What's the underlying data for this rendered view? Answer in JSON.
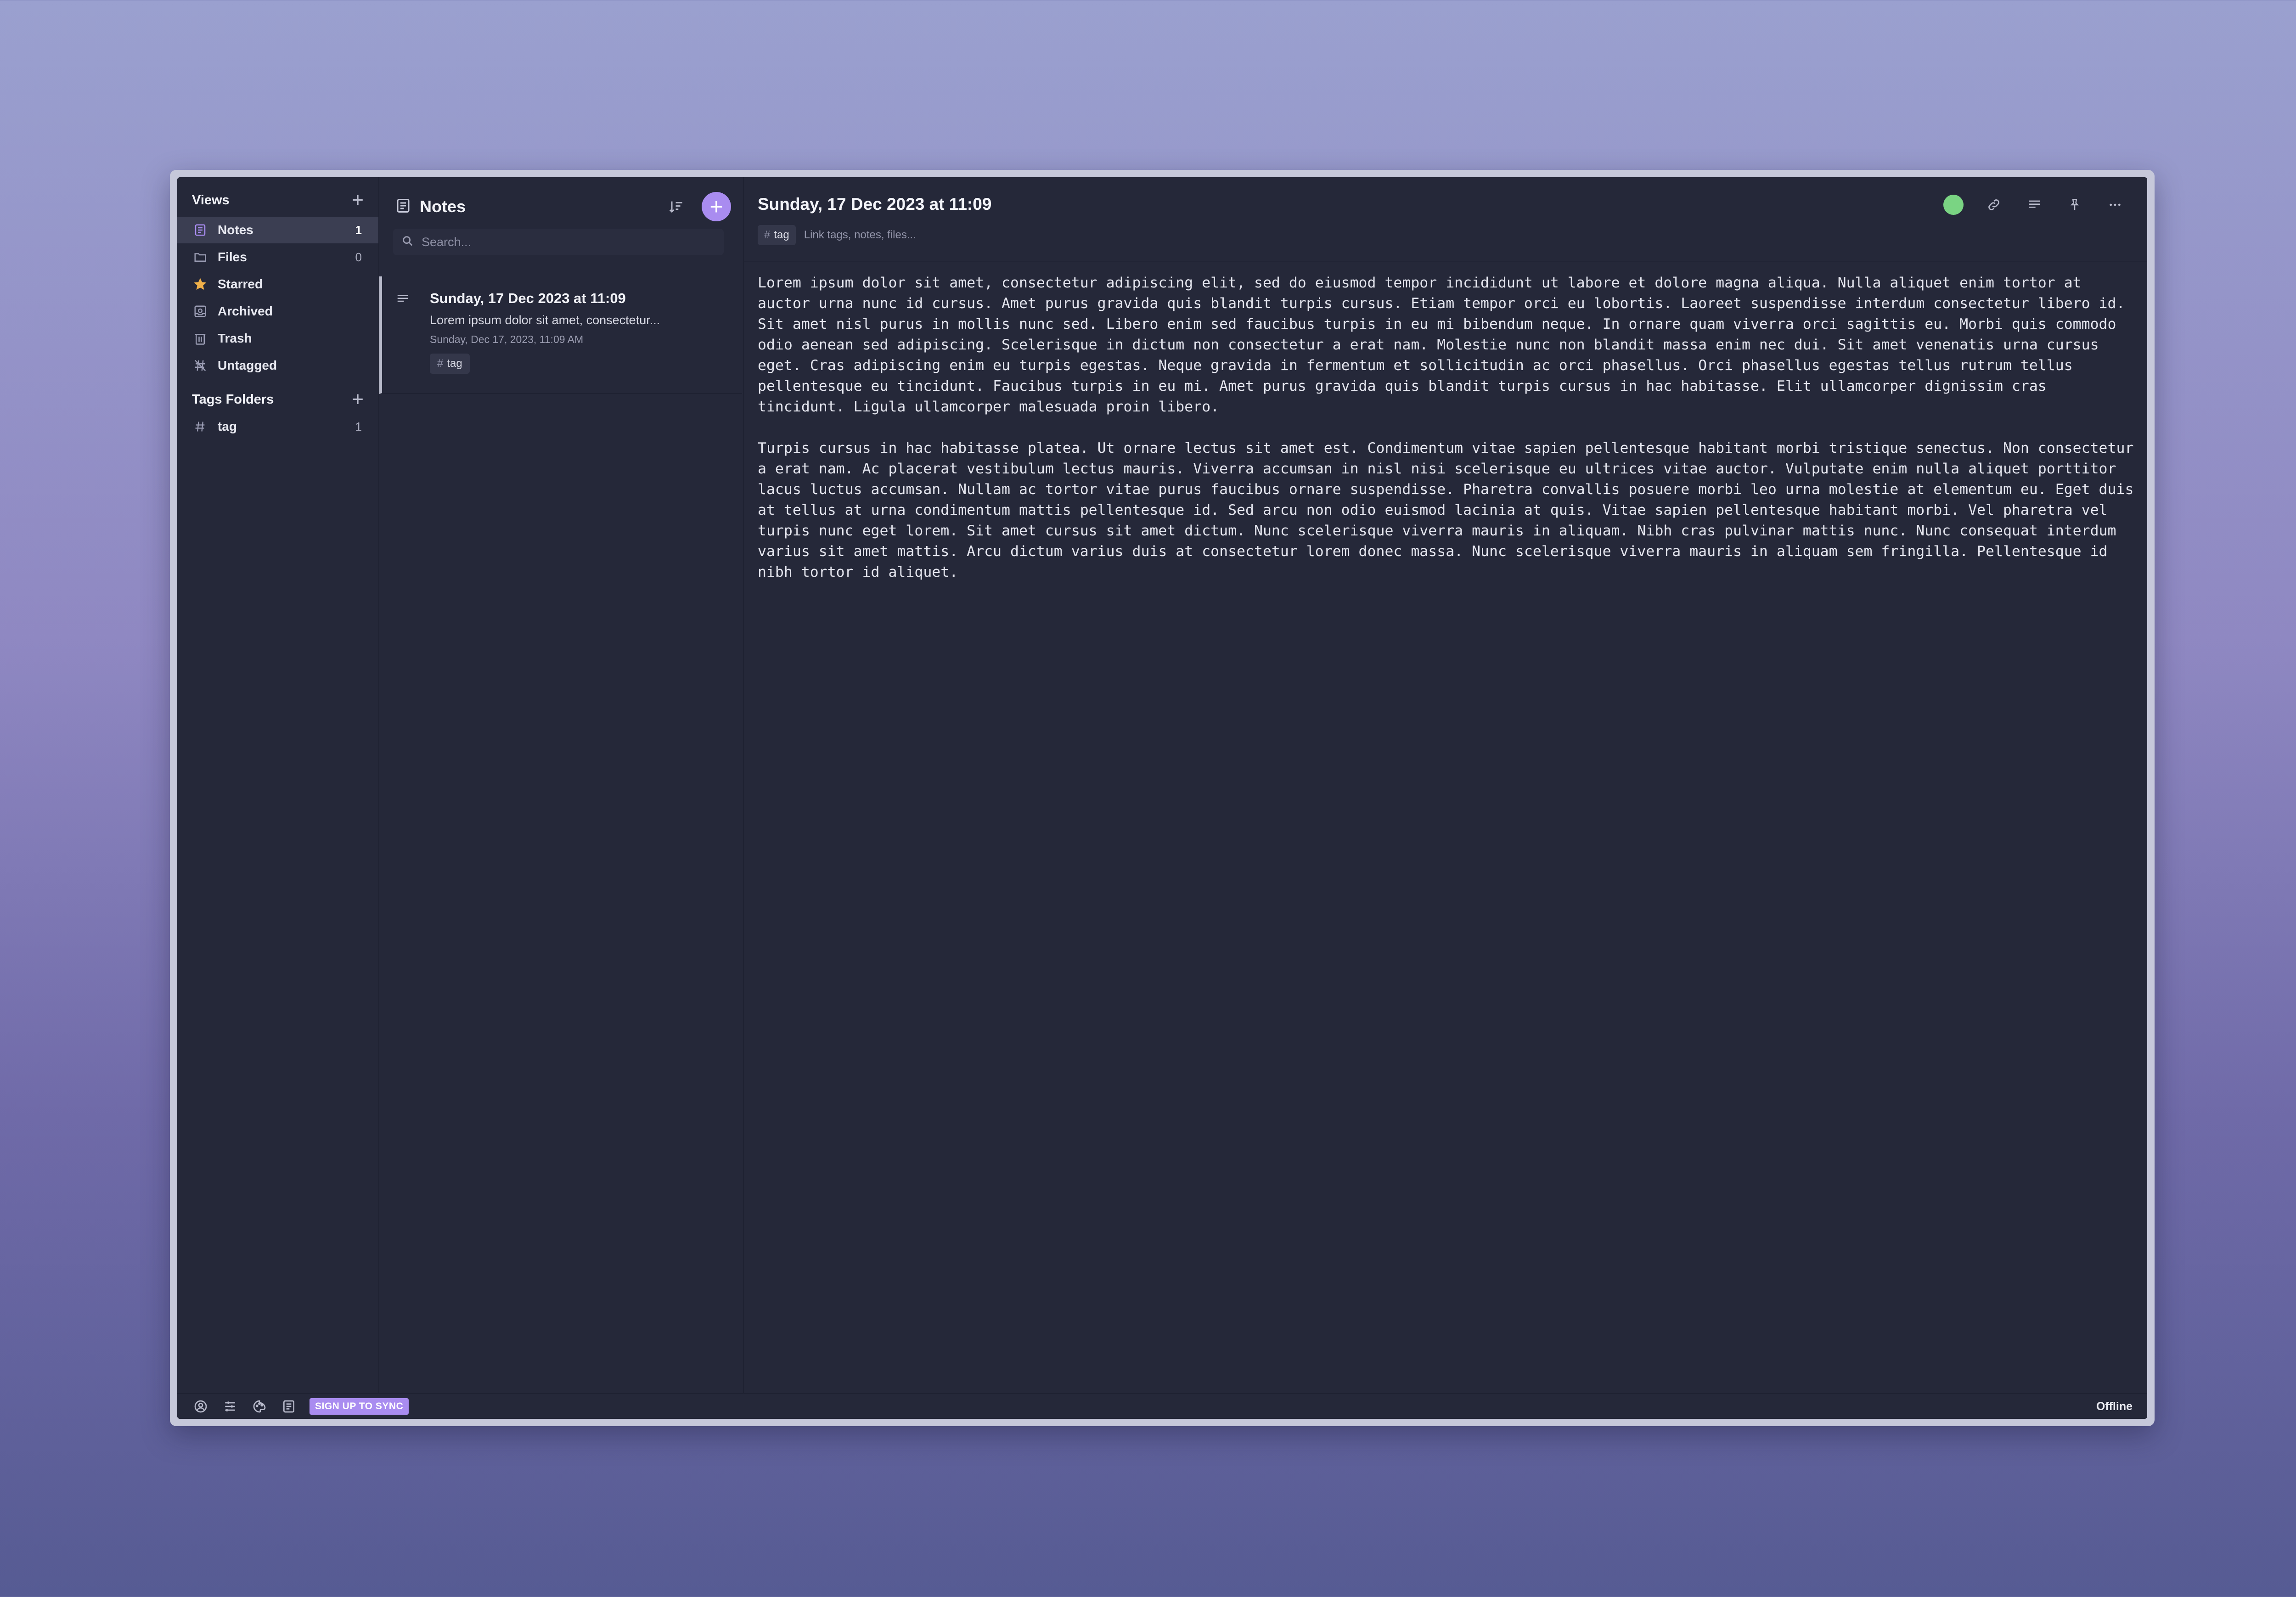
{
  "sidebar": {
    "views_title": "Views",
    "items": [
      {
        "label": "Notes",
        "count": "1",
        "icon": "notes-icon"
      },
      {
        "label": "Files",
        "count": "0",
        "icon": "folder-icon"
      },
      {
        "label": "Starred",
        "count": "",
        "icon": "star-icon"
      },
      {
        "label": "Archived",
        "count": "",
        "icon": "archive-icon"
      },
      {
        "label": "Trash",
        "count": "",
        "icon": "trash-icon"
      },
      {
        "label": "Untagged",
        "count": "",
        "icon": "untagged-icon"
      }
    ],
    "tags_title": "Tags Folders",
    "tags": [
      {
        "label": "tag",
        "count": "1"
      }
    ]
  },
  "notes_list": {
    "title": "Notes",
    "search_placeholder": "Search...",
    "notes": [
      {
        "title": "Sunday, 17 Dec 2023 at 11:09",
        "preview": "Lorem ipsum dolor sit amet, consectetur...",
        "date": "Sunday, Dec 17, 2023, 11:09 AM",
        "tag": "tag"
      }
    ]
  },
  "editor": {
    "title": "Sunday, 17 Dec 2023 at 11:09",
    "tag": "tag",
    "tag_input_placeholder": "Link tags, notes, files...",
    "paragraphs": [
      "Lorem ipsum dolor sit amet, consectetur adipiscing elit, sed do eiusmod tempor incididunt ut labore et dolore magna aliqua. Nulla aliquet enim tortor at auctor urna nunc id cursus. Amet purus gravida quis blandit turpis cursus. Etiam tempor orci eu lobortis. Laoreet suspendisse interdum consectetur libero id. Sit amet nisl purus in mollis nunc sed. Libero enim sed faucibus turpis in eu mi bibendum neque. In ornare quam viverra orci sagittis eu. Morbi quis commodo odio aenean sed adipiscing. Scelerisque in dictum non consectetur a erat nam. Molestie nunc non blandit massa enim nec dui. Sit amet venenatis urna cursus eget. Cras adipiscing enim eu turpis egestas. Neque gravida in fermentum et sollicitudin ac orci phasellus. Orci phasellus egestas tellus rutrum tellus pellentesque eu tincidunt. Faucibus turpis in eu mi. Amet purus gravida quis blandit turpis cursus in hac habitasse. Elit ullamcorper dignissim cras tincidunt. Ligula ullamcorper malesuada proin libero.",
      "Turpis cursus in hac habitasse platea. Ut ornare lectus sit amet est. Condimentum vitae sapien pellentesque habitant morbi tristique senectus. Non consectetur a erat nam. Ac placerat vestibulum lectus mauris. Viverra accumsan in nisl nisi scelerisque eu ultrices vitae auctor. Vulputate enim nulla aliquet porttitor lacus luctus accumsan. Nullam ac tortor vitae purus faucibus ornare suspendisse. Pharetra convallis posuere morbi leo urna molestie at elementum eu. Eget duis at tellus at urna condimentum mattis pellentesque id. Sed arcu non odio euismod lacinia at quis. Vitae sapien pellentesque habitant morbi. Vel pharetra vel turpis nunc eget lorem. Sit amet cursus sit amet dictum. Nunc scelerisque viverra mauris in aliquam. Nibh cras pulvinar mattis nunc. Nunc consequat interdum varius sit amet mattis. Arcu dictum varius duis at consectetur lorem donec massa. Nunc scelerisque viverra mauris in aliquam sem fringilla. Pellentesque id nibh tortor id aliquet."
    ]
  },
  "footer": {
    "sync_label": "SIGN UP TO SYNC",
    "status": "Offline"
  },
  "colors": {
    "accent": "#a98cf0",
    "status_green": "#7ad483",
    "star": "#f0b04a",
    "panel_bg": "#252839"
  }
}
